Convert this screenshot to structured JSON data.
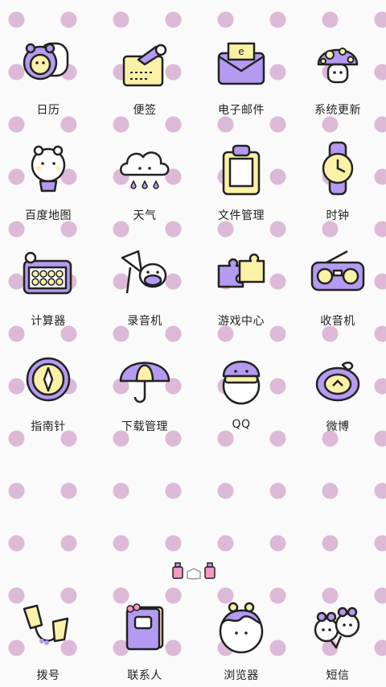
{
  "apps": [
    {
      "label": "日历",
      "icon": "calendar-hamster-icon"
    },
    {
      "label": "便签",
      "icon": "notes-icon"
    },
    {
      "label": "电子邮件",
      "icon": "email-envelope-icon"
    },
    {
      "label": "系统更新",
      "icon": "mushroom-update-icon"
    },
    {
      "label": "百度地图",
      "icon": "map-hot-air-balloon-icon"
    },
    {
      "label": "天气",
      "icon": "weather-cloud-icon"
    },
    {
      "label": "文件管理",
      "icon": "clipboard-files-icon"
    },
    {
      "label": "时钟",
      "icon": "wristwatch-icon"
    },
    {
      "label": "计算器",
      "icon": "abacus-calculator-icon"
    },
    {
      "label": "录音机",
      "icon": "recorder-cow-icon"
    },
    {
      "label": "游戏中心",
      "icon": "puzzle-game-icon"
    },
    {
      "label": "收音机",
      "icon": "boombox-radio-icon"
    },
    {
      "label": "指南针",
      "icon": "compass-icon"
    },
    {
      "label": "下载管理",
      "icon": "umbrella-download-icon"
    },
    {
      "label": "QQ",
      "icon": "qq-penguin-icon"
    },
    {
      "label": "微博",
      "icon": "weibo-pouch-icon"
    }
  ],
  "dock": [
    {
      "label": "拨号",
      "icon": "phone-cups-icon"
    },
    {
      "label": "联系人",
      "icon": "contacts-book-icon"
    },
    {
      "label": "浏览器",
      "icon": "browser-globe-icon"
    },
    {
      "label": "短信",
      "icon": "messages-bunnies-icon"
    }
  ],
  "pager": {
    "pages": 3,
    "current": 2
  },
  "colors": {
    "purple": "#a98ee8",
    "yellow": "#fbf1a6",
    "polka": "#dcb9d6",
    "background": "#fbfafb"
  }
}
